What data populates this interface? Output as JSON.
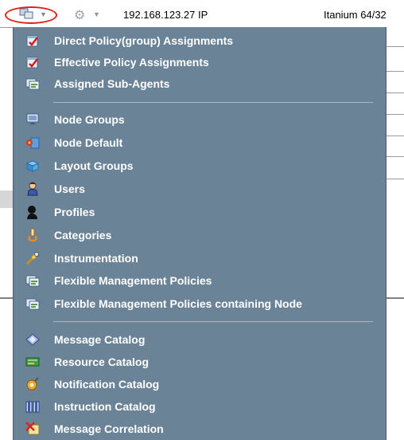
{
  "toolbar": {
    "ip": "192.168.123.27   IP",
    "os": "Itanium 64/32"
  },
  "menu": {
    "items": [
      {
        "label": "Direct Policy(group) Assignments",
        "icon": "policy-check-icon"
      },
      {
        "label": "Effective Policy Assignments",
        "icon": "policy-check-icon"
      },
      {
        "label": "Assigned Sub-Agents",
        "icon": "subagent-icon"
      },
      {
        "label": "Node Groups",
        "icon": "node-groups-icon"
      },
      {
        "label": "Node Default",
        "icon": "node-default-icon"
      },
      {
        "label": "Layout Groups",
        "icon": "layout-groups-icon"
      },
      {
        "label": "Users",
        "icon": "users-icon"
      },
      {
        "label": "Profiles",
        "icon": "profiles-icon"
      },
      {
        "label": "Categories",
        "icon": "categories-icon"
      },
      {
        "label": "Instrumentation",
        "icon": "instrumentation-icon"
      },
      {
        "label": "Flexible Management Policies",
        "icon": "flexible-policies-icon"
      },
      {
        "label": "Flexible Management Policies containing Node",
        "icon": "flexible-policies-icon"
      },
      {
        "label": "Message Catalog",
        "icon": "message-catalog-icon"
      },
      {
        "label": "Resource Catalog",
        "icon": "resource-catalog-icon"
      },
      {
        "label": "Notification Catalog",
        "icon": "notification-catalog-icon"
      },
      {
        "label": "Instruction Catalog",
        "icon": "instruction-catalog-icon"
      },
      {
        "label": "Message Correlation",
        "icon": "message-correlation-icon"
      }
    ]
  },
  "colors": {
    "menu_bg": "#6b8397",
    "highlight_ring": "#e0201a"
  }
}
